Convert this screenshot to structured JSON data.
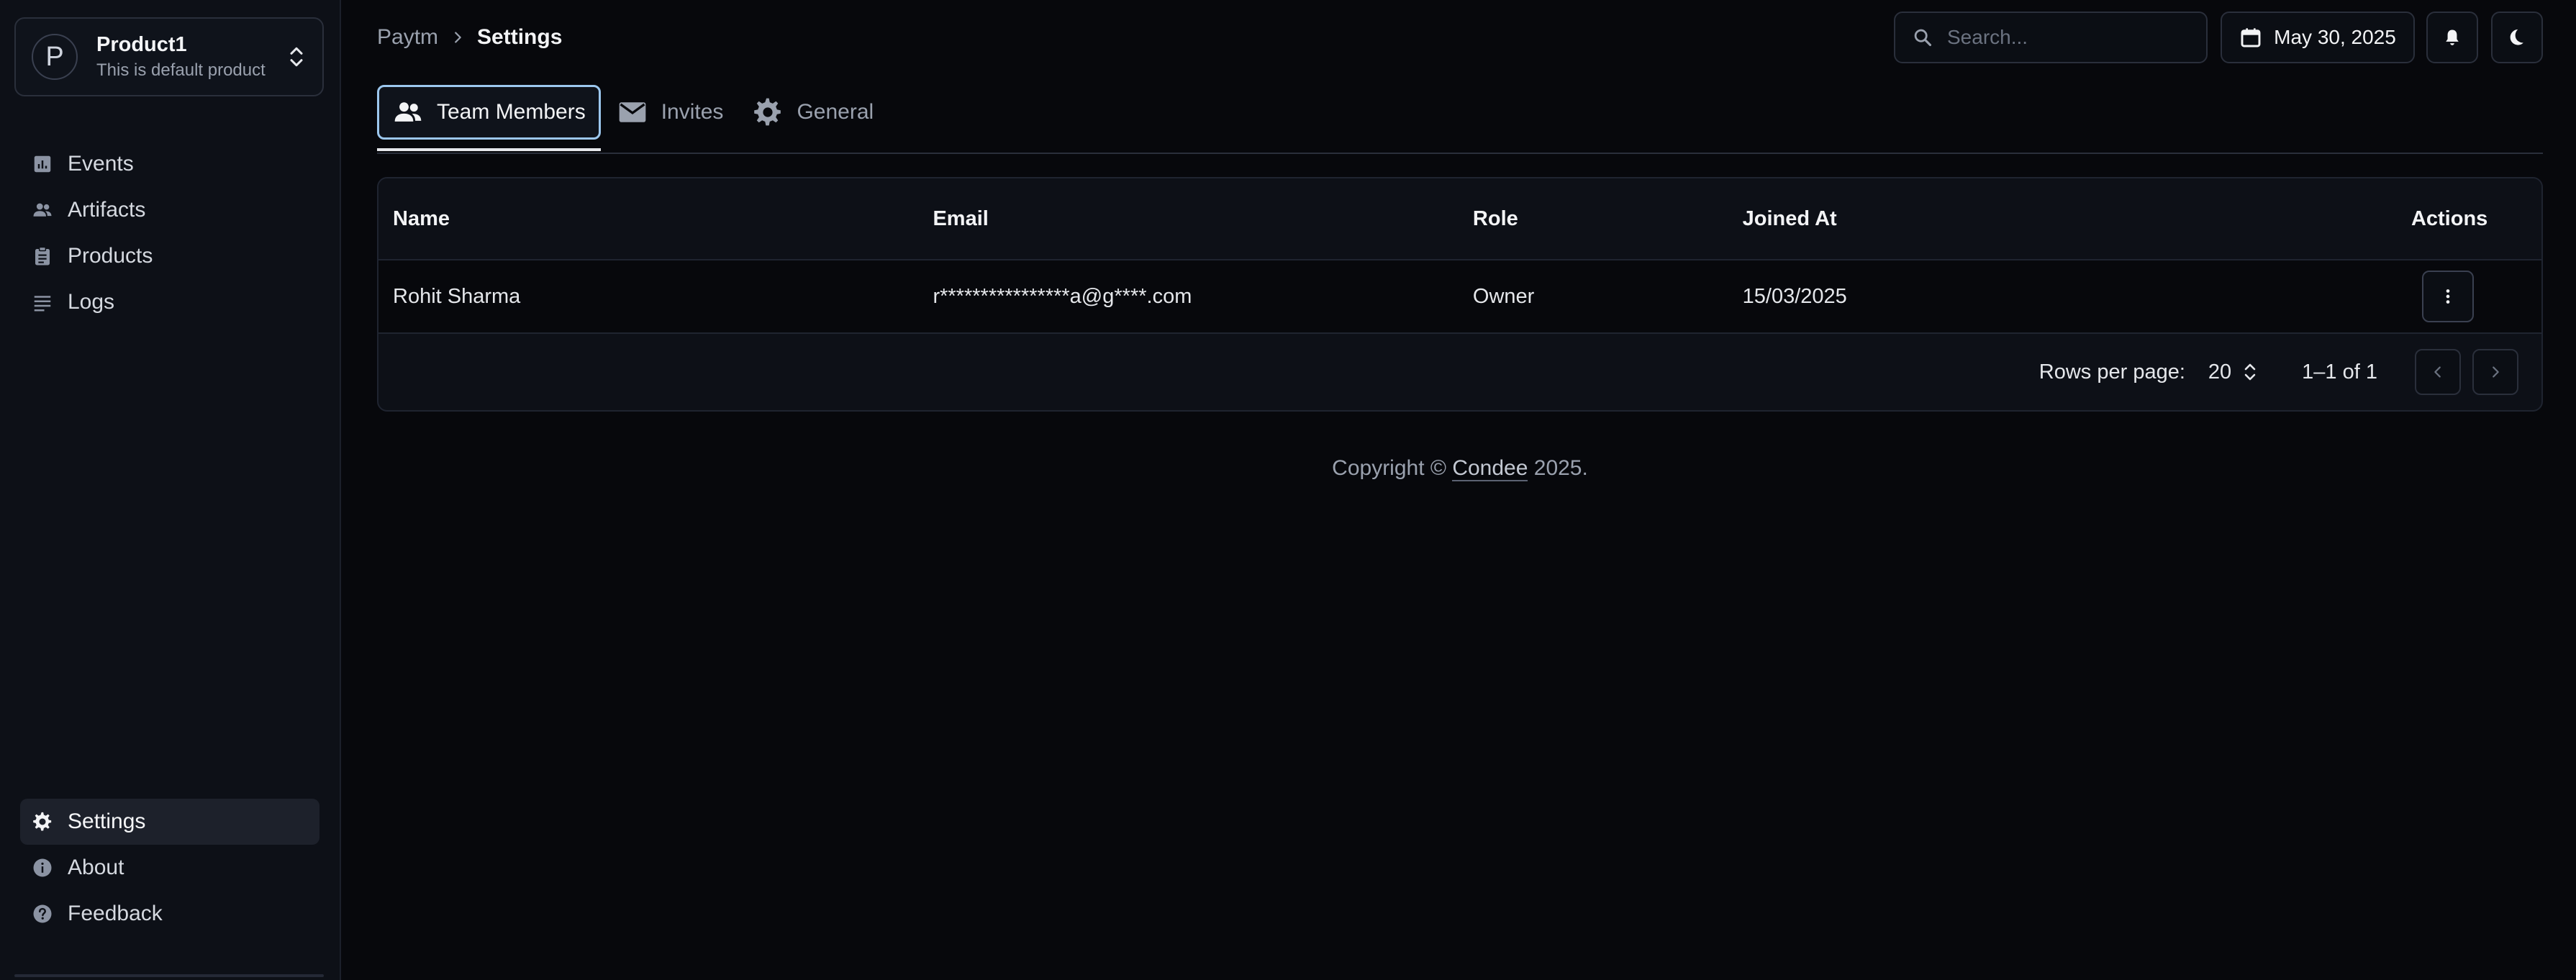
{
  "product": {
    "avatar_letter": "P",
    "name": "Product1",
    "description": "This is default product"
  },
  "sidebar": {
    "top_items": [
      {
        "label": "Events",
        "icon": "chart-icon"
      },
      {
        "label": "Artifacts",
        "icon": "people-icon"
      },
      {
        "label": "Products",
        "icon": "clipboard-icon"
      },
      {
        "label": "Logs",
        "icon": "lines-icon"
      }
    ],
    "bottom_items": [
      {
        "label": "Settings",
        "icon": "gear-icon",
        "active": true
      },
      {
        "label": "About",
        "icon": "info-icon"
      },
      {
        "label": "Feedback",
        "icon": "help-icon"
      }
    ]
  },
  "breadcrumb": {
    "parent": "Paytm",
    "current": "Settings"
  },
  "header": {
    "search_placeholder": "Search...",
    "date": "May 30, 2025"
  },
  "tabs": [
    {
      "label": "Team Members",
      "icon": "people-icon",
      "active": true
    },
    {
      "label": "Invites",
      "icon": "mail-icon"
    },
    {
      "label": "General",
      "icon": "gear-icon"
    }
  ],
  "table": {
    "columns": [
      "Name",
      "Email",
      "Role",
      "Joined At",
      "Actions"
    ],
    "rows": [
      {
        "name": "Rohit Sharma",
        "email": "r****************a@g****.com",
        "role": "Owner",
        "joined": "15/03/2025"
      }
    ],
    "footer": {
      "rows_per_page_label": "Rows per page:",
      "rows_per_page": "20",
      "range": "1–1 of 1"
    }
  },
  "footer": {
    "prefix": "Copyright © ",
    "brand": "Condee",
    "suffix": " 2025."
  },
  "colors": {
    "background": "#07080c",
    "sidebar": "#0d1017",
    "active_tab_border": "#9cc7ee"
  }
}
